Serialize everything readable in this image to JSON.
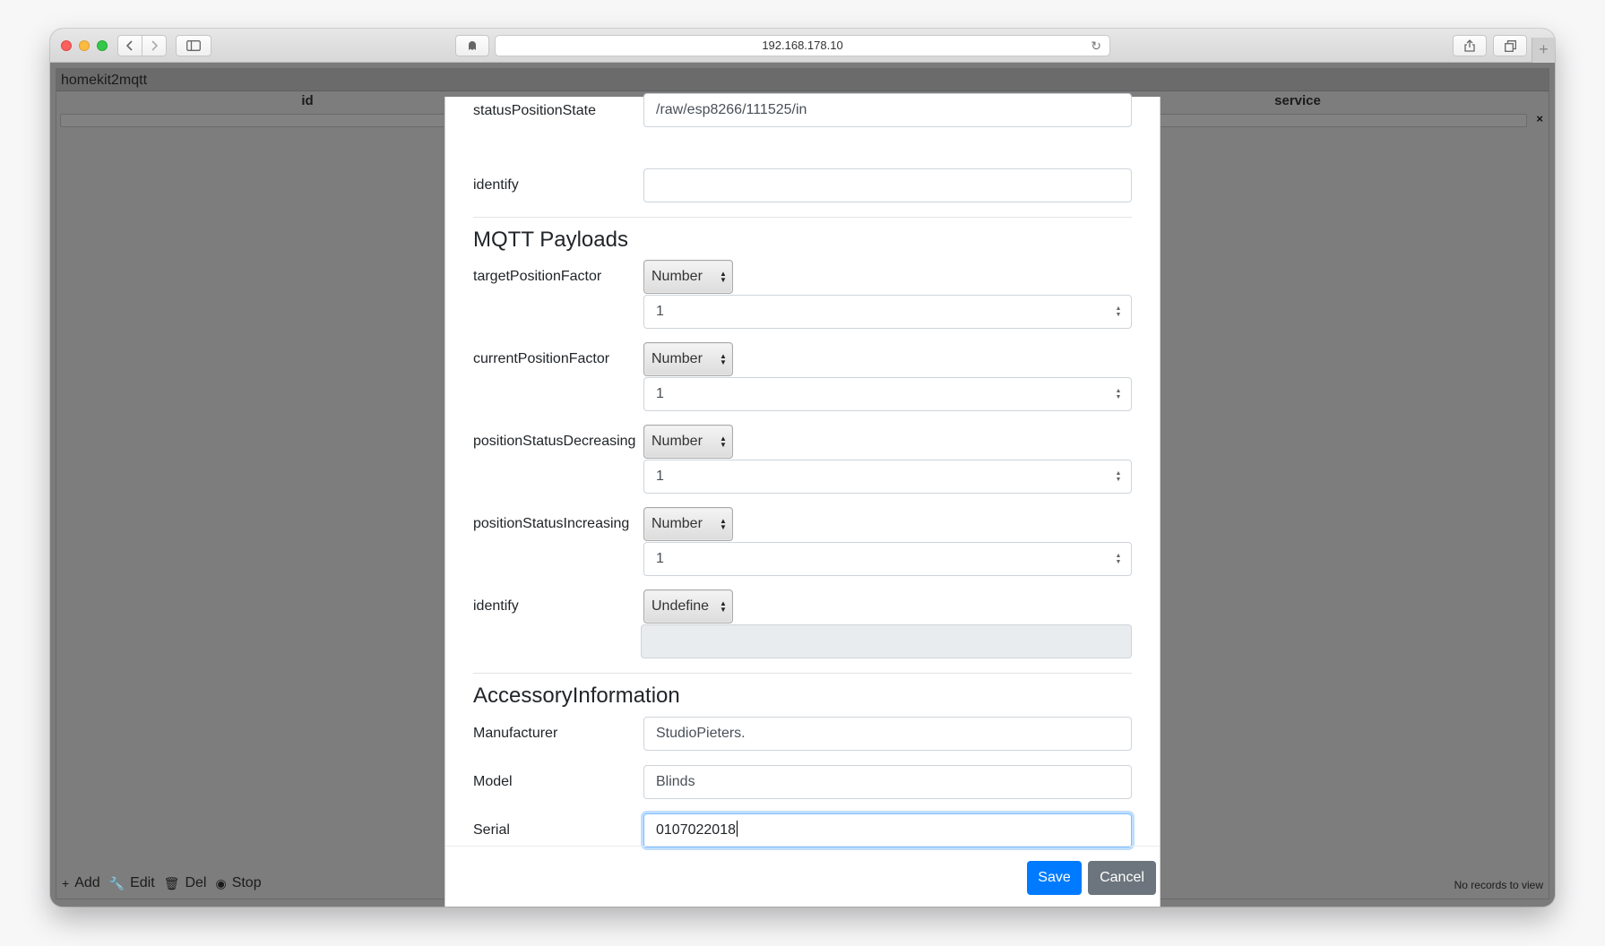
{
  "browser": {
    "address": "192.168.178.10",
    "reload_icon": "reload-icon",
    "plus": "+"
  },
  "grid": {
    "caption": "homekit2mqtt",
    "columns": {
      "id": "id",
      "service": "service"
    },
    "filter_clear": "×",
    "actions": [
      {
        "icon": "+",
        "label": "Add"
      },
      {
        "icon": "🔧",
        "label": "Edit"
      },
      {
        "icon": "🗑",
        "label": "Del"
      },
      {
        "icon": "◉",
        "label": "Stop"
      }
    ],
    "records": "No records to view"
  },
  "form": {
    "status_position_state": {
      "label": "statusPositionState",
      "value": "/raw/esp8266/111525/in"
    },
    "identify_topic": {
      "label": "identify",
      "value": ""
    },
    "payloads_title": "MQTT Payloads",
    "payloads": [
      {
        "label": "targetPositionFactor",
        "type": "Number",
        "value": "1"
      },
      {
        "label": "currentPositionFactor",
        "type": "Number",
        "value": "1"
      },
      {
        "label": "positionStatusDecreasing",
        "type": "Number",
        "value": "1"
      },
      {
        "label": "positionStatusIncreasing",
        "type": "Number",
        "value": "1"
      }
    ],
    "identify_payload": {
      "label": "identify",
      "type": "Undefine",
      "value": ""
    },
    "accessory_title": "AccessoryInformation",
    "manufacturer": {
      "label": "Manufacturer",
      "value": "StudioPieters."
    },
    "model": {
      "label": "Model",
      "value": "Blinds"
    },
    "serial": {
      "label": "Serial",
      "value": "0107022018"
    }
  },
  "footer": {
    "save": "Save",
    "cancel": "Cancel"
  },
  "colors": {
    "primary": "#007bff",
    "secondary": "#6c757d",
    "focus": "#80bdff"
  }
}
